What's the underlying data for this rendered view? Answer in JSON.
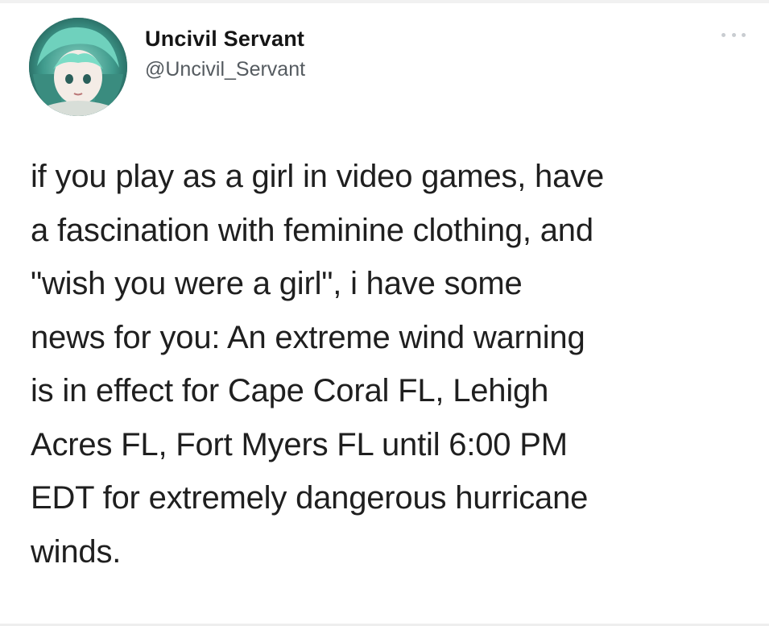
{
  "tweet": {
    "author": {
      "display_name": "Uncivil Servant",
      "handle": "@Uncivil_Servant",
      "avatar_icon": "anime-character-avatar"
    },
    "more_icon": "ellipsis-icon",
    "text_lines": [
      "if you play as a girl in video games, have",
      "a fascination with feminine clothing, and",
      "\"wish you were a girl\", i have some",
      "news for you: An extreme wind warning",
      "is in effect for Cape Coral FL, Lehigh",
      "Acres FL, Fort Myers FL until 6:00 PM",
      "EDT for extremely dangerous hurricane",
      "winds."
    ]
  },
  "colors": {
    "background": "#ffffff",
    "text": "#1f1f1f",
    "handle": "#555b60",
    "avatar_primary": "#2e6f6a"
  }
}
